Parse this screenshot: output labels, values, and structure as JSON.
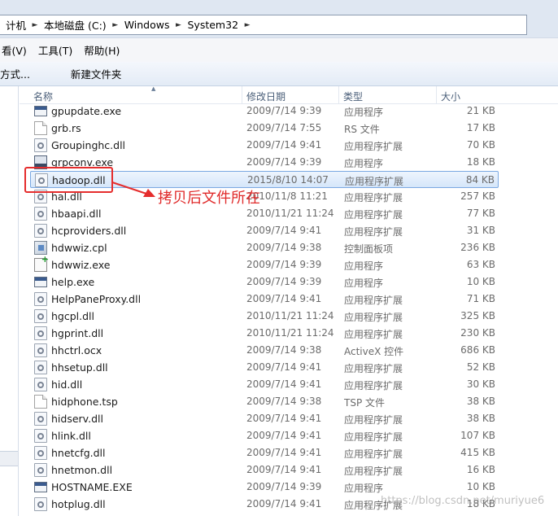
{
  "address": {
    "crumbs": [
      "计机",
      "本地磁盘 (C:)",
      "Windows",
      "System32"
    ]
  },
  "menu": {
    "items": [
      "看(V)",
      "工具(T)",
      "帮助(H)"
    ]
  },
  "toolbar": {
    "items": [
      "方式...",
      "新建文件夹"
    ]
  },
  "columns": {
    "name": "名称",
    "date": "修改日期",
    "type": "类型",
    "size": "大小"
  },
  "files": [
    {
      "name": "gpupdate.exe",
      "date": "2009/7/14 9:39",
      "type": "应用程序",
      "size": "21 KB",
      "icon": "exe-icon"
    },
    {
      "name": "grb.rs",
      "date": "2009/7/14 7:55",
      "type": "RS 文件",
      "size": "17 KB",
      "icon": "document-icon"
    },
    {
      "name": "Groupinghc.dll",
      "date": "2009/7/14 9:41",
      "type": "应用程序扩展",
      "size": "70 KB",
      "icon": "dll-icon"
    },
    {
      "name": "grpconv.exe",
      "date": "2009/7/14 9:39",
      "type": "应用程序",
      "size": "18 KB",
      "icon": "grpconv-icon"
    },
    {
      "name": "hadoop.dll",
      "date": "2015/8/10 14:07",
      "type": "应用程序扩展",
      "size": "84 KB",
      "icon": "dll-icon",
      "selected": true
    },
    {
      "name": "hal.dll",
      "date": "2010/11/8 11:21",
      "type": "应用程序扩展",
      "size": "257 KB",
      "icon": "dll-icon"
    },
    {
      "name": "hbaapi.dll",
      "date": "2010/11/21 11:24",
      "type": "应用程序扩展",
      "size": "77 KB",
      "icon": "dll-icon"
    },
    {
      "name": "hcproviders.dll",
      "date": "2009/7/14 9:41",
      "type": "应用程序扩展",
      "size": "31 KB",
      "icon": "dll-icon"
    },
    {
      "name": "hdwwiz.cpl",
      "date": "2009/7/14 9:38",
      "type": "控制面板项",
      "size": "236 KB",
      "icon": "cpl-icon"
    },
    {
      "name": "hdwwiz.exe",
      "date": "2009/7/14 9:39",
      "type": "应用程序",
      "size": "63 KB",
      "icon": "hardware-wizard-icon"
    },
    {
      "name": "help.exe",
      "date": "2009/7/14 9:39",
      "type": "应用程序",
      "size": "10 KB",
      "icon": "exe-icon"
    },
    {
      "name": "HelpPaneProxy.dll",
      "date": "2009/7/14 9:41",
      "type": "应用程序扩展",
      "size": "71 KB",
      "icon": "dll-icon"
    },
    {
      "name": "hgcpl.dll",
      "date": "2010/11/21 11:24",
      "type": "应用程序扩展",
      "size": "325 KB",
      "icon": "dll-icon"
    },
    {
      "name": "hgprint.dll",
      "date": "2010/11/21 11:24",
      "type": "应用程序扩展",
      "size": "230 KB",
      "icon": "dll-icon"
    },
    {
      "name": "hhctrl.ocx",
      "date": "2009/7/14 9:38",
      "type": "ActiveX 控件",
      "size": "686 KB",
      "icon": "dll-icon"
    },
    {
      "name": "hhsetup.dll",
      "date": "2009/7/14 9:41",
      "type": "应用程序扩展",
      "size": "52 KB",
      "icon": "dll-icon"
    },
    {
      "name": "hid.dll",
      "date": "2009/7/14 9:41",
      "type": "应用程序扩展",
      "size": "30 KB",
      "icon": "dll-icon"
    },
    {
      "name": "hidphone.tsp",
      "date": "2009/7/14 9:38",
      "type": "TSP 文件",
      "size": "38 KB",
      "icon": "document-icon"
    },
    {
      "name": "hidserv.dll",
      "date": "2009/7/14 9:41",
      "type": "应用程序扩展",
      "size": "38 KB",
      "icon": "dll-icon"
    },
    {
      "name": "hlink.dll",
      "date": "2009/7/14 9:41",
      "type": "应用程序扩展",
      "size": "107 KB",
      "icon": "dll-icon"
    },
    {
      "name": "hnetcfg.dll",
      "date": "2009/7/14 9:41",
      "type": "应用程序扩展",
      "size": "415 KB",
      "icon": "dll-icon"
    },
    {
      "name": "hnetmon.dll",
      "date": "2009/7/14 9:41",
      "type": "应用程序扩展",
      "size": "16 KB",
      "icon": "dll-icon"
    },
    {
      "name": "HOSTNAME.EXE",
      "date": "2009/7/14 9:39",
      "type": "应用程序",
      "size": "10 KB",
      "icon": "exe-icon"
    },
    {
      "name": "hotplug.dll",
      "date": "2009/7/14 9:41",
      "type": "应用程序扩展",
      "size": "18 KB",
      "icon": "dll-icon"
    }
  ],
  "annotation": {
    "text": "拷贝后文件所在",
    "color": "#e02a2a"
  },
  "watermark": "https://blog.csdn.net/muriyue6"
}
